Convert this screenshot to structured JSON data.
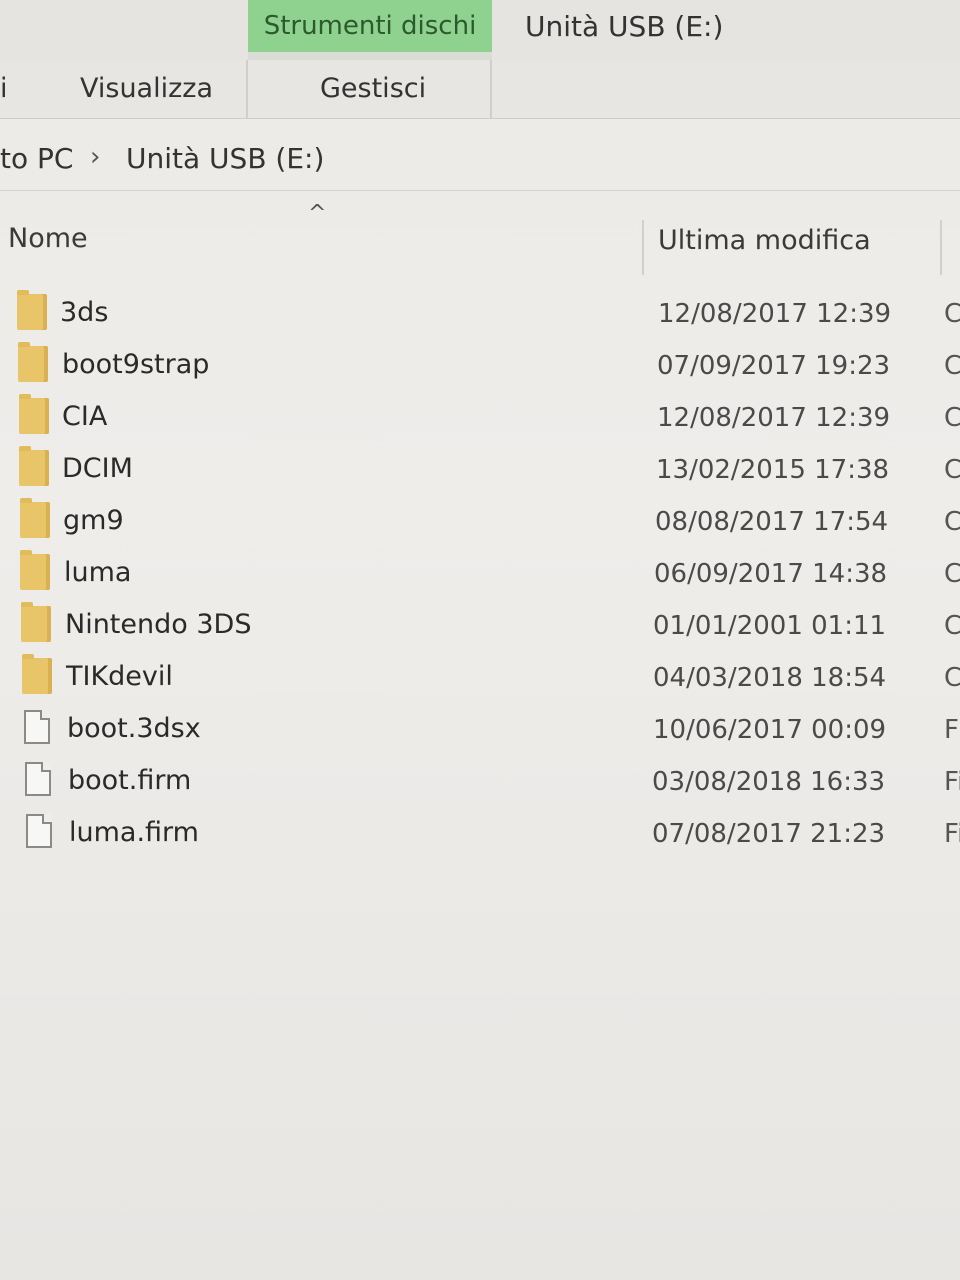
{
  "ribbon": {
    "context_tab_group": "Strumenti dischi",
    "window_title": "Unità USB (E:)",
    "tabs": [
      {
        "label": "i"
      },
      {
        "label": "Visualizza"
      },
      {
        "label": "Gestisci"
      }
    ]
  },
  "address_bar": {
    "crumbs": [
      "to PC",
      "Unità USB (E:)"
    ],
    "separator": "›"
  },
  "columns": {
    "name": "Nome",
    "modified": "Ultima modifica",
    "sort_indicator": "^"
  },
  "files": [
    {
      "name": "3ds",
      "modified": "12/08/2017 12:39",
      "type_initial": "C",
      "kind": "folder"
    },
    {
      "name": "boot9strap",
      "modified": "07/09/2017 19:23",
      "type_initial": "C",
      "kind": "folder"
    },
    {
      "name": "CIA",
      "modified": "12/08/2017 12:39",
      "type_initial": "C",
      "kind": "folder"
    },
    {
      "name": "DCIM",
      "modified": "13/02/2015 17:38",
      "type_initial": "C",
      "kind": "folder"
    },
    {
      "name": "gm9",
      "modified": "08/08/2017 17:54",
      "type_initial": "C",
      "kind": "folder"
    },
    {
      "name": "luma",
      "modified": "06/09/2017 14:38",
      "type_initial": "C",
      "kind": "folder"
    },
    {
      "name": "Nintendo 3DS",
      "modified": "01/01/2001 01:11",
      "type_initial": "C",
      "kind": "folder"
    },
    {
      "name": "TIKdevil",
      "modified": "04/03/2018 18:54",
      "type_initial": "C",
      "kind": "folder"
    },
    {
      "name": "boot.3dsx",
      "modified": "10/06/2017 00:09",
      "type_initial": "F",
      "kind": "file"
    },
    {
      "name": "boot.firm",
      "modified": "03/08/2018 16:33",
      "type_initial": "Fi",
      "kind": "file"
    },
    {
      "name": "luma.firm",
      "modified": "07/08/2017 21:23",
      "type_initial": "Fi",
      "kind": "file"
    }
  ],
  "colors": {
    "context_tab_green": "#8fd18f",
    "folder_yellow": "#e9c56a",
    "background": "#eceae7"
  }
}
